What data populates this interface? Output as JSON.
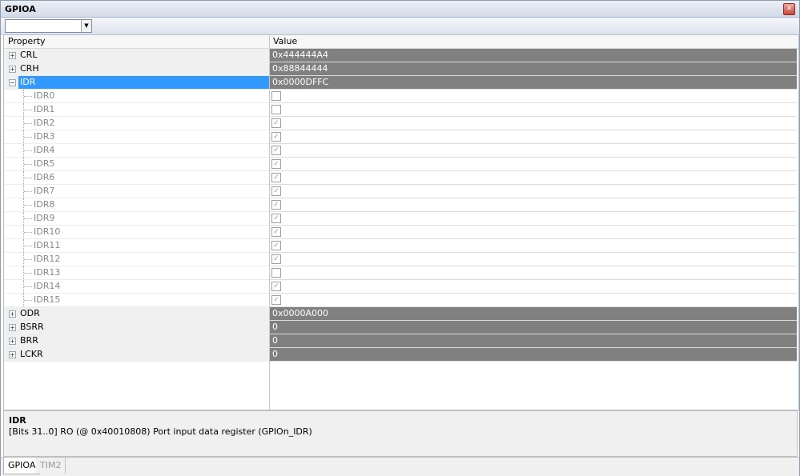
{
  "window": {
    "title": "GPIOA",
    "close_symbol": "✕"
  },
  "toolbar": {
    "combo_value": "",
    "combo_arrow": "▼"
  },
  "grid": {
    "header_property": "Property",
    "header_value": "Value",
    "rows": [
      {
        "kind": "reg",
        "name": "CRL",
        "value": "0x444444A4",
        "expander": "+"
      },
      {
        "kind": "reg",
        "name": "CRH",
        "value": "0x88844444",
        "expander": "+"
      },
      {
        "kind": "reg",
        "name": "IDR",
        "value": "0x0000DFFC",
        "expander": "−",
        "selected": true
      },
      {
        "kind": "bit",
        "name": "IDR0",
        "checked": false
      },
      {
        "kind": "bit",
        "name": "IDR1",
        "checked": false
      },
      {
        "kind": "bit",
        "name": "IDR2",
        "checked": true
      },
      {
        "kind": "bit",
        "name": "IDR3",
        "checked": true
      },
      {
        "kind": "bit",
        "name": "IDR4",
        "checked": true
      },
      {
        "kind": "bit",
        "name": "IDR5",
        "checked": true
      },
      {
        "kind": "bit",
        "name": "IDR6",
        "checked": true
      },
      {
        "kind": "bit",
        "name": "IDR7",
        "checked": true
      },
      {
        "kind": "bit",
        "name": "IDR8",
        "checked": true
      },
      {
        "kind": "bit",
        "name": "IDR9",
        "checked": true
      },
      {
        "kind": "bit",
        "name": "IDR10",
        "checked": true
      },
      {
        "kind": "bit",
        "name": "IDR11",
        "checked": true
      },
      {
        "kind": "bit",
        "name": "IDR12",
        "checked": true
      },
      {
        "kind": "bit",
        "name": "IDR13",
        "checked": false
      },
      {
        "kind": "bit",
        "name": "IDR14",
        "checked": true
      },
      {
        "kind": "bit",
        "name": "IDR15",
        "checked": true
      },
      {
        "kind": "reg",
        "name": "ODR",
        "value": "0x0000A000",
        "expander": "+"
      },
      {
        "kind": "reg",
        "name": "BSRR",
        "value": "0",
        "expander": "+"
      },
      {
        "kind": "reg",
        "name": "BRR",
        "value": "0",
        "expander": "+"
      },
      {
        "kind": "reg",
        "name": "LCKR",
        "value": "0",
        "expander": "+"
      }
    ]
  },
  "description": {
    "title": "IDR",
    "text": "[Bits 31..0] RO (@ 0x40010808) Port input data register  (GPIOn_IDR)"
  },
  "tabs": [
    {
      "label": "GPIOA",
      "active": true
    },
    {
      "label": "TIM2",
      "active": false
    }
  ],
  "icons": {
    "check": "✓",
    "expander": "plus-minus-box",
    "close": "close-icon"
  },
  "colors": {
    "selection": "#3399ff",
    "register_value_bg": "#808080",
    "bit_label": "#888888"
  }
}
